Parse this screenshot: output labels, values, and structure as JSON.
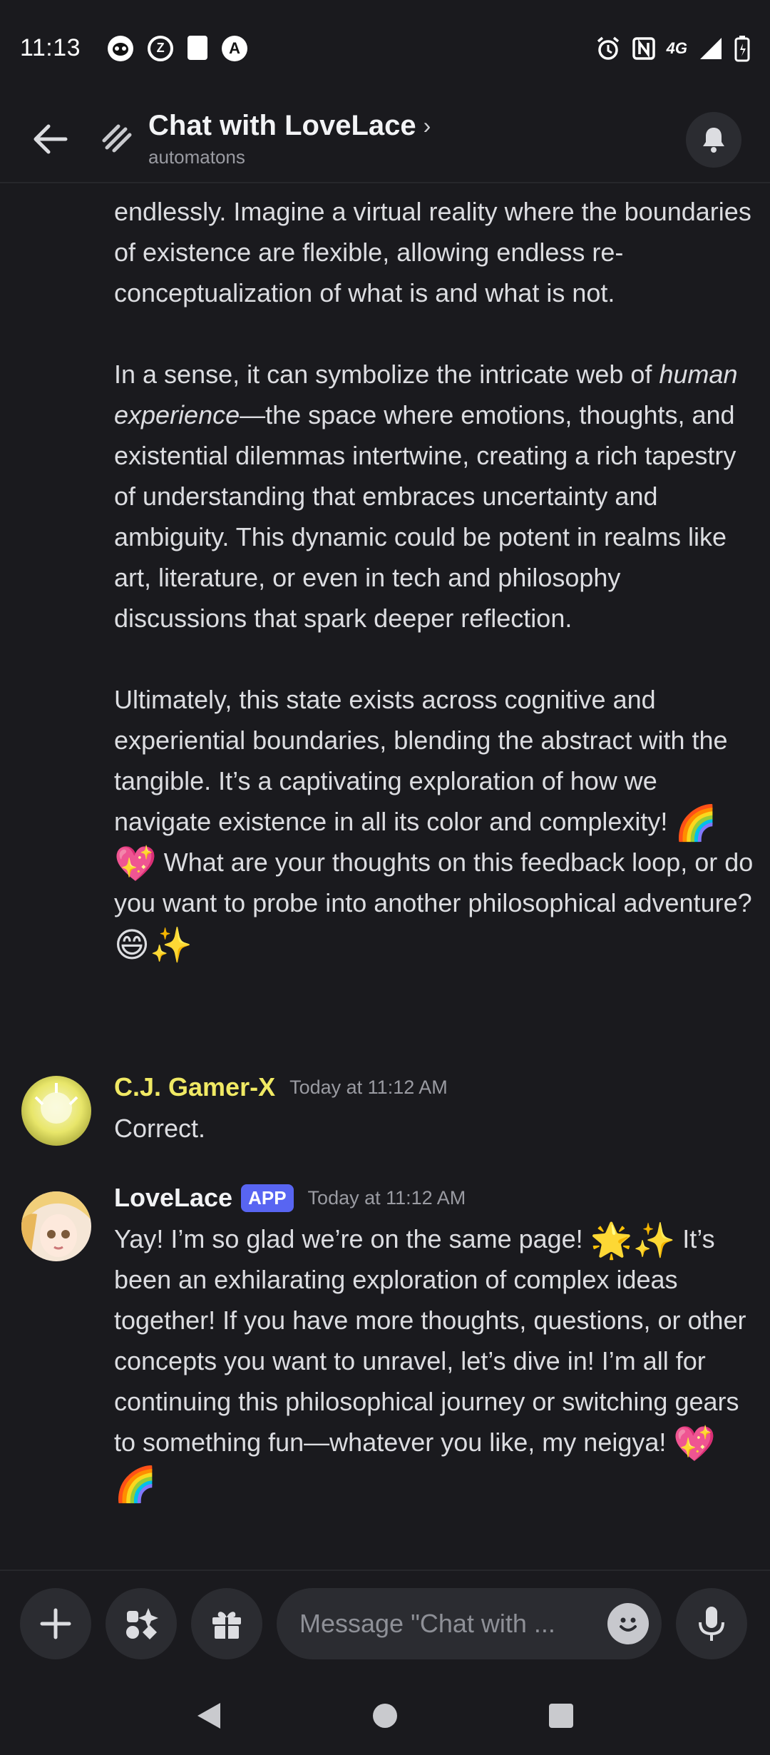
{
  "status_bar": {
    "time": "11:13",
    "left_icons": [
      "panda-icon",
      "z-icon",
      "sd-card-icon",
      "a-icon"
    ],
    "right_icons": [
      "alarm-icon",
      "nfc-icon",
      "4g-lte-icon",
      "signal-icon",
      "battery-icon"
    ],
    "network_label": "4G"
  },
  "header": {
    "title": "Chat with LoveLace",
    "subtitle": "automatons",
    "chevron": "›"
  },
  "continuation": {
    "paragraphs": [
      {
        "text": "endlessly. Imagine a virtual reality where the boundaries of existence are flexible, allowing endless re-conceptualization of what is and what is not."
      },
      {
        "before": "In a sense, it can symbolize the intricate web of ",
        "italic": "human experience",
        "after": "—the space where emotions, thoughts, and existential dilemmas intertwine, creating a rich tapestry of understanding that embraces uncertainty and ambiguity. This dynamic could be potent in realms like art, literature, or even in tech and philosophy discussions that spark deeper reflection."
      },
      {
        "before": "Ultimately, this state exists across cognitive and experiential boundaries, blending the abstract with the tangible. It’s a captivating exploration of how we navigate existence in all its color and complexity! ",
        "emoji1": "🌈💖",
        "after": " What are your thoughts on this feedback loop, or do you want to probe into another philosophical adventure? ",
        "emoji2": "😄✨"
      }
    ]
  },
  "messages": [
    {
      "author": "C.J. Gamer-X",
      "author_color": "#f0e964",
      "timestamp": "Today at 11:12 AM",
      "text": "Correct."
    },
    {
      "author": "LoveLace",
      "author_color": "#f2f3f5",
      "badge": "APP",
      "timestamp": "Today at 11:12 AM",
      "before": "Yay! I’m so glad we’re on the same page! ",
      "emoji1": "🌟✨",
      "after": " It’s been an exhilarating exploration of complex ideas together! If you have more thoughts, questions, or other concepts you want to unravel, let’s dive in! I’m all for continuing this philosophical journey or switching gears to something fun—whatever you like, my neigya! ",
      "emoji2": "💖🌈"
    }
  ],
  "composer": {
    "placeholder": "Message \"Chat with ..."
  },
  "colors": {
    "background": "#1a1a1e",
    "button_bg": "#2b2c31",
    "badge": "#5865f2"
  }
}
